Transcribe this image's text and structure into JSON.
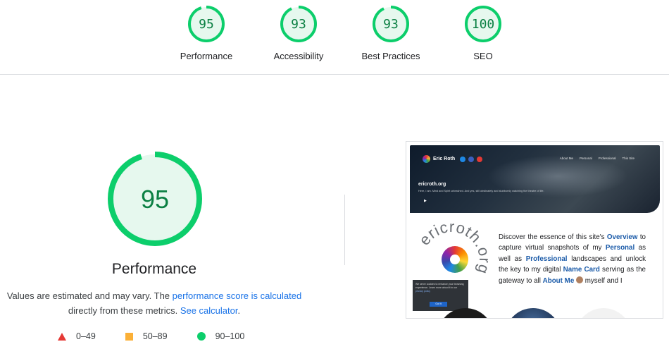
{
  "summary": {
    "gauges": [
      {
        "score": "95",
        "label": "Performance",
        "value": 95
      },
      {
        "score": "93",
        "label": "Accessibility",
        "value": 93
      },
      {
        "score": "93",
        "label": "Best Practices",
        "value": 93
      },
      {
        "score": "100",
        "label": "SEO",
        "value": 100
      }
    ]
  },
  "performance": {
    "score": "95",
    "value": 95,
    "title": "Performance",
    "desc_1": "Values are estimated and may vary. The ",
    "desc_link_1": "performance score is calculated",
    "desc_2": "directly from these metrics. ",
    "desc_link_2": "See calculator",
    "desc_end": "."
  },
  "legend": [
    {
      "icon": "red-triangle-icon",
      "range": "0–49"
    },
    {
      "icon": "orange-square-icon",
      "range": "50–89"
    },
    {
      "icon": "green-circle-icon",
      "range": "90–100"
    }
  ],
  "colors": {
    "pass": "#0cce6b",
    "pass_text": "#0b8043",
    "pass_bg": "#e6f8ee",
    "link": "#1a73e8"
  },
  "screenshot": {
    "brand": "Eric Roth",
    "nav": [
      "About Me",
      "Personal",
      "Professional",
      "This Site"
    ],
    "hero_title": "ericroth.org",
    "hero_text": "Here, I am. Mind and Spirit unleashed. And yes, still obstinately and stubbornly watching the theatre of life.",
    "ring_text": "ericroth.org",
    "about_1": "Discover the essence of this site's ",
    "about_overview": "Overview",
    "about_2": " to capture virtual snapshots of my ",
    "about_personal": "Personal",
    "about_3": " as well as ",
    "about_professional": "Professional",
    "about_4": " landscapes and unlock the key to my digital ",
    "about_namecard": "Name Card",
    "about_5": " serving as the gateway to all ",
    "about_aboutme": "About Me",
    "about_6": " myself and I",
    "cookie_text": "We serve cookies to enhance your browsing experience. Learn more about it in our",
    "cookie_link": "privacy policy",
    "cookie_button": "Got it"
  }
}
